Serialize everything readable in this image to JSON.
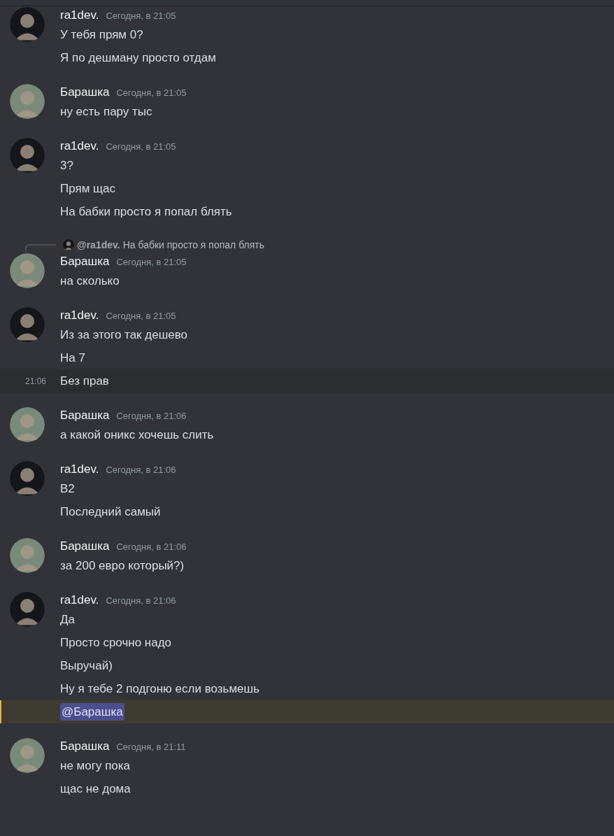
{
  "messages": [
    {
      "author": "ra1dev.",
      "color": "#15161a",
      "timestamp": "Сегодня, в 21:05",
      "lines": [
        {
          "text": "У тебя прям 0?"
        },
        {
          "text": "Я по дешману просто отдам"
        }
      ]
    },
    {
      "author": "Барашка",
      "color": "#7a8a7a",
      "timestamp": "Сегодня, в 21:05",
      "lines": [
        {
          "text": "ну есть пару тыс"
        }
      ]
    },
    {
      "author": "ra1dev.",
      "color": "#15161a",
      "timestamp": "Сегодня, в 21:05",
      "lines": [
        {
          "text": "3?"
        },
        {
          "text": "Прям щас"
        },
        {
          "text": "На бабки просто я попал блять"
        }
      ]
    },
    {
      "author": "Барашка",
      "color": "#7a8a7a",
      "timestamp": "Сегодня, в 21:05",
      "reply": {
        "author": "@ra1dev.",
        "color": "#15161a",
        "text": "На бабки просто я попал блять"
      },
      "lines": [
        {
          "text": "на сколько"
        }
      ]
    },
    {
      "author": "ra1dev.",
      "color": "#15161a",
      "timestamp": "Сегодня, в 21:05",
      "lines": [
        {
          "text": "Из за этого так дешево"
        },
        {
          "text": "На 7"
        },
        {
          "text": "Без прав",
          "time": "21:06",
          "highlighted": true
        }
      ]
    },
    {
      "author": "Барашка",
      "color": "#7a8a7a",
      "timestamp": "Сегодня, в 21:06",
      "lines": [
        {
          "text": "а какой оникс хочешь слить"
        }
      ]
    },
    {
      "author": "ra1dev.",
      "color": "#15161a",
      "timestamp": "Сегодня, в 21:06",
      "lines": [
        {
          "text": "B2"
        },
        {
          "text": "Последний самый"
        }
      ]
    },
    {
      "author": "Барашка",
      "color": "#7a8a7a",
      "timestamp": "Сегодня, в 21:06",
      "lines": [
        {
          "text": "за 200 евро который?)"
        }
      ]
    },
    {
      "author": "ra1dev.",
      "color": "#15161a",
      "timestamp": "Сегодня, в 21:06",
      "lines": [
        {
          "text": "Да"
        },
        {
          "text": "Просто срочно надо"
        },
        {
          "text": "Выручай)"
        },
        {
          "text": "Ну я тебе 2 подгоню если возьмешь"
        },
        {
          "text": "@Барашка",
          "kind": "mention",
          "mentioned": true
        }
      ]
    },
    {
      "author": "Барашка",
      "color": "#7a8a7a",
      "timestamp": "Сегодня, в 21:11",
      "lines": [
        {
          "text": "не могу пока"
        },
        {
          "text": "щас не дома"
        }
      ]
    }
  ]
}
